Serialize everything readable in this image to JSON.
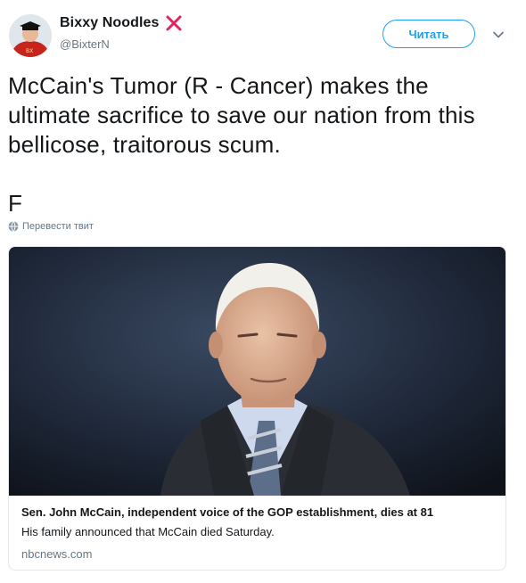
{
  "author": {
    "display_name": "Bixxy Noodles",
    "handle": "@BixterN",
    "avatar_label": "BX"
  },
  "follow_button_label": "Читать",
  "tweet": {
    "text": "McCain's Tumor (R - Cancer) makes the ultimate sacrifice to save our nation from this bellicose, traitorous scum.",
    "tail": "F"
  },
  "translate_label": "Перевести твит",
  "card": {
    "title": "Sen. John McCain, independent voice of the GOP establishment, dies at 81",
    "description": "His family announced that McCain died Saturday.",
    "domain": "nbcnews.com"
  },
  "icons": {
    "name_badge": "red-x-icon",
    "menu": "chevron-down-icon",
    "translate": "globe-icon"
  },
  "colors": {
    "accent": "#1da1f2",
    "secondary_text": "#657786",
    "x_mark": "#e0245e"
  }
}
